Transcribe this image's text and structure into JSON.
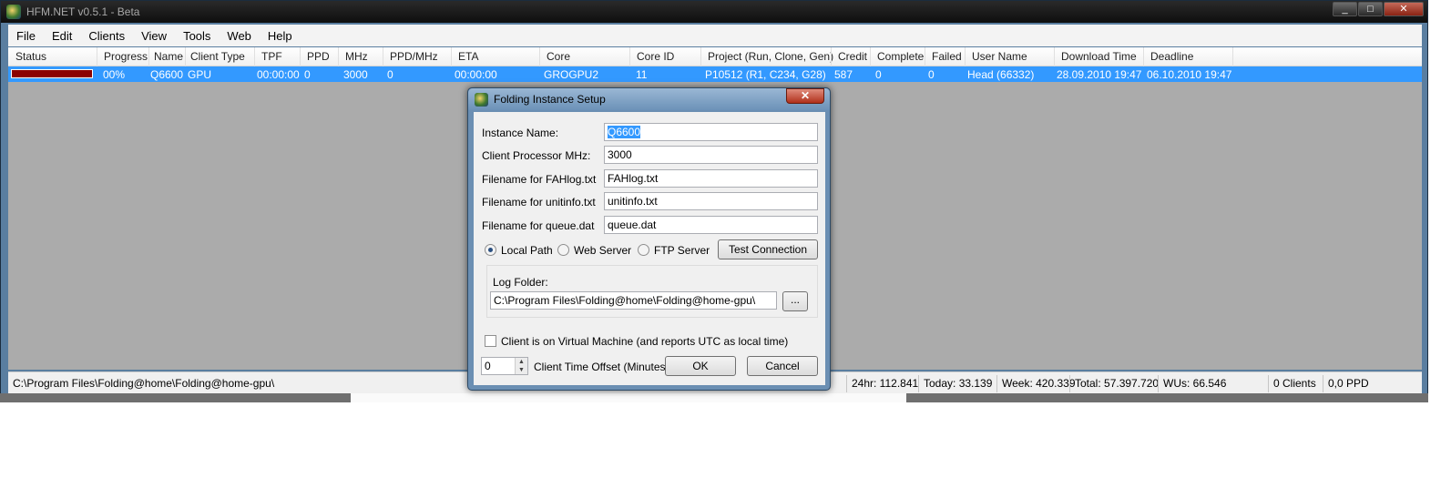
{
  "window": {
    "title": "HFM.NET v0.5.1 - Beta",
    "min": "_",
    "max": "□",
    "close": "✕"
  },
  "menu": [
    "File",
    "Edit",
    "Clients",
    "View",
    "Tools",
    "Web",
    "Help"
  ],
  "grid": {
    "columns": [
      "Status",
      "Progress",
      "Name",
      "Client Type",
      "TPF",
      "PPD",
      "MHz",
      "PPD/MHz",
      "ETA",
      "Core",
      "Core ID",
      "Project (Run, Clone, Gen)",
      "Credit",
      "Complete",
      "Failed",
      "User Name",
      "Download Time",
      "Deadline"
    ],
    "row": [
      "",
      "00%",
      "Q6600",
      "GPU",
      "00:00:00",
      "0",
      "3000",
      "0",
      "00:00:00",
      "GROGPU2",
      "11",
      "P10512 (R1, C234, G28)",
      "587",
      "0",
      "0",
      "Head (66332)",
      "28.09.2010 19:47",
      "06.10.2010 19:47"
    ],
    "status_color": "#8b0000"
  },
  "statusbar": {
    "path": "C:\\Program Files\\Folding@home\\Folding@home-gpu\\",
    "h24": "24hr: 112.841",
    "today": "Today: 33.139",
    "week": "Week: 420.339",
    "total": "Total: 57.397.720",
    "wus": "WUs: 66.546",
    "clients": "0 Clients",
    "ppd": "0,0 PPD"
  },
  "dialog": {
    "title": "Folding Instance Setup",
    "close": "✕",
    "instance_name_label": "Instance Name:",
    "instance_name": "Q6600",
    "mhz_label": "Client Processor MHz:",
    "mhz": "3000",
    "fahlog_label": "Filename for FAHlog.txt",
    "fahlog": "FAHlog.txt",
    "unitinfo_label": "Filename for unitinfo.txt",
    "unitinfo": "unitinfo.txt",
    "queue_label": "Filename for queue.dat",
    "queue": "queue.dat",
    "radio_local": "Local Path",
    "radio_web": "Web Server",
    "radio_ftp": "FTP Server",
    "test_connection": "Test Connection",
    "log_folder_label": "Log Folder:",
    "log_folder": "C:\\Program Files\\Folding@home\\Folding@home-gpu\\",
    "browse": "...",
    "vm_label": "Client is on Virtual Machine (and reports UTC as local time)",
    "offset_value": "0",
    "offset_label": "Client Time Offset (Minutes)",
    "ok": "OK",
    "cancel": "Cancel"
  }
}
